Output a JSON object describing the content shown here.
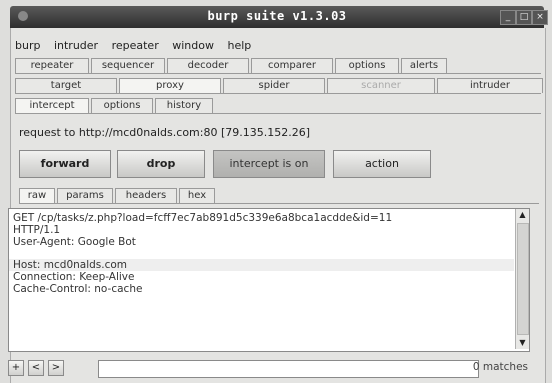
{
  "window": {
    "title": "burp suite v1.3.03"
  },
  "menu": [
    "burp",
    "intruder",
    "repeater",
    "window",
    "help"
  ],
  "tools_row1": [
    "repeater",
    "sequencer",
    "decoder",
    "comparer",
    "options",
    "alerts"
  ],
  "tools_row2": [
    "target",
    "proxy",
    "spider",
    "scanner",
    "intruder"
  ],
  "proxy_tabs": [
    "intercept",
    "options",
    "history"
  ],
  "request_info": "request to http://mcd0nalds.com:80  [79.135.152.26]",
  "buttons": {
    "forward": "forward",
    "drop": "drop",
    "intercept": "intercept is on",
    "action": "action"
  },
  "view_tabs": [
    "raw",
    "params",
    "headers",
    "hex"
  ],
  "request_lines": [
    "GET /cp/tasks/z.php?load=fcff7ec7ab891d5c339e6a8bca1acdde&id=11",
    "HTTP/1.1",
    "User-Agent: Google Bot",
    "Host: mcd0nalds.com",
    "Connection: Keep-Alive",
    "Cache-Control: no-cache"
  ],
  "search": {
    "value": "",
    "matches": "0 matches"
  },
  "nav_buttons": [
    "+",
    "<",
    ">"
  ]
}
